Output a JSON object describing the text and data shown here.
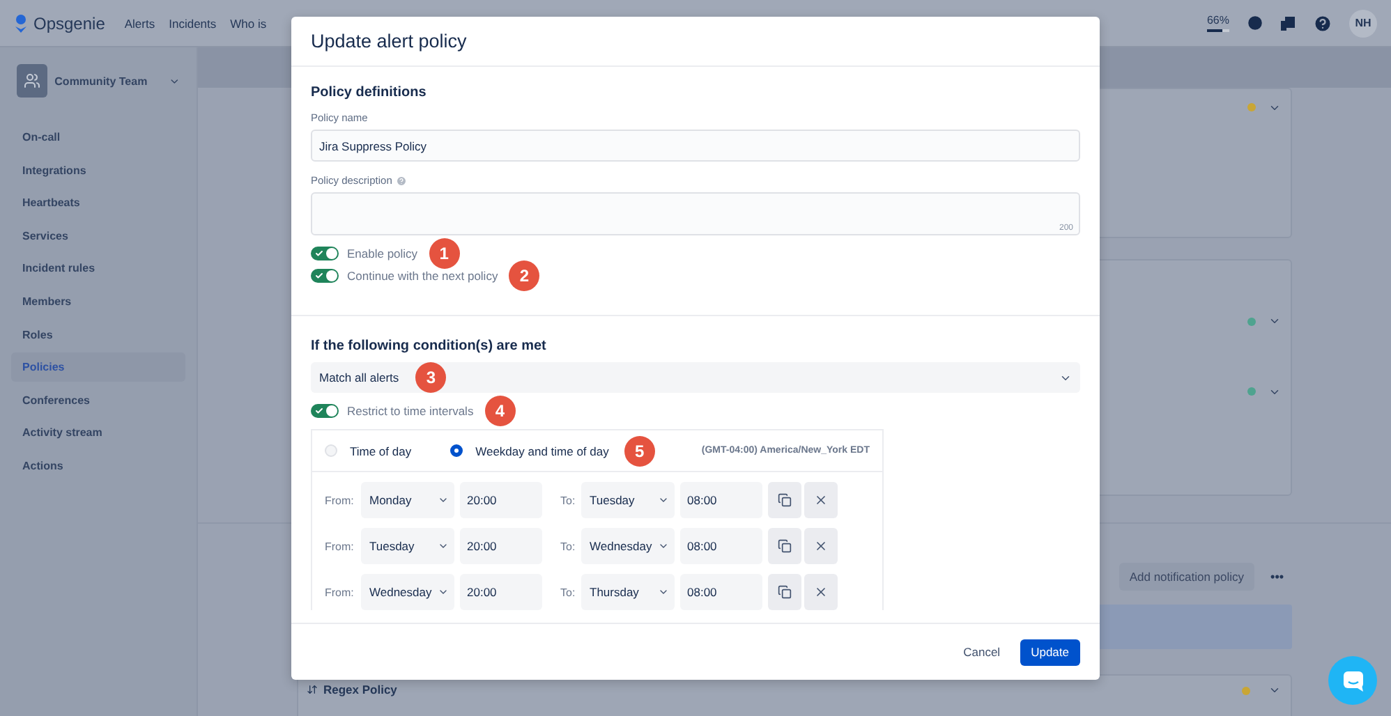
{
  "top_nav": {
    "logo": "Opsgenie",
    "links": [
      "Alerts",
      "Incidents",
      "Who is"
    ],
    "progress": {
      "label": "66%",
      "level": 0.66
    },
    "avatar": "NH"
  },
  "sidebar": {
    "team": "Community Team",
    "items": [
      {
        "label": "On-call",
        "selected": false
      },
      {
        "label": "Integrations",
        "selected": false
      },
      {
        "label": "Heartbeats",
        "selected": false
      },
      {
        "label": "Services",
        "selected": false
      },
      {
        "label": "Incident rules",
        "selected": false
      },
      {
        "label": "Members",
        "selected": false
      },
      {
        "label": "Roles",
        "selected": false
      },
      {
        "label": "Policies",
        "selected": true
      },
      {
        "label": "Conferences",
        "selected": false
      },
      {
        "label": "Activity stream",
        "selected": false
      },
      {
        "label": "Actions",
        "selected": false
      }
    ]
  },
  "background": {
    "cards": [
      {
        "rows": [
          {
            "color": "#c9a635"
          }
        ]
      },
      {
        "rows": [
          {
            "color": "#4fa38f"
          },
          {
            "color": "#4fa38f"
          }
        ]
      }
    ],
    "add_button": "Add notification policy",
    "more_button": "•••",
    "regex_policy": {
      "title": "Regex Policy",
      "color": "#c9a635"
    }
  },
  "dialog": {
    "title": "Update alert policy",
    "definitions": {
      "heading": "Policy definitions",
      "name_label": "Policy name",
      "name_value": "Jira Suppress Policy",
      "description_label": "Policy description",
      "description_counter": "200",
      "toggles": [
        {
          "label": "Enable policy",
          "on": true,
          "marker": "1"
        },
        {
          "label": "Continue with the next policy",
          "on": true,
          "marker": "2"
        }
      ]
    },
    "conditions": {
      "heading": "If the following condition(s) are met",
      "match": {
        "value": "Match all alerts",
        "marker": "3"
      },
      "restrict": {
        "label": "Restrict to time intervals",
        "on": true,
        "marker": "4"
      },
      "interval_types": [
        {
          "label": "Time of day",
          "selected": false
        },
        {
          "label": "Weekday and time of day",
          "selected": true,
          "marker": "5"
        }
      ],
      "timezone": "(GMT-04:00) America/New_York EDT",
      "intervals": [
        {
          "from_label": "From:",
          "from_day": "Monday",
          "from_time": "20:00",
          "to_label": "To:",
          "to_day": "Tuesday",
          "to_time": "08:00"
        },
        {
          "from_label": "From:",
          "from_day": "Tuesday",
          "from_time": "20:00",
          "to_label": "To:",
          "to_day": "Wednesday",
          "to_time": "08:00"
        },
        {
          "from_label": "From:",
          "from_day": "Wednesday",
          "from_time": "20:00",
          "to_label": "To:",
          "to_day": "Thursday",
          "to_time": "08:00"
        }
      ]
    },
    "buttons": {
      "cancel": "Cancel",
      "update": "Update"
    }
  }
}
